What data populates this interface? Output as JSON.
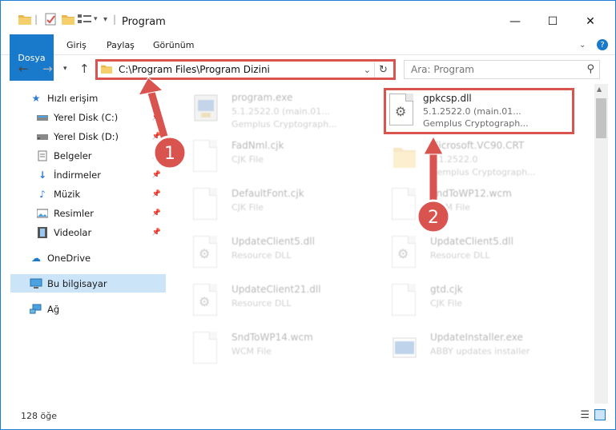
{
  "window": {
    "title": "Program",
    "controls": {
      "minimize": "—",
      "maximize": "☐",
      "close": "✕"
    }
  },
  "ribbon": {
    "tabs": [
      {
        "label": "Dosya"
      },
      {
        "label": "Giriş"
      },
      {
        "label": "Paylaş"
      },
      {
        "label": "Görünüm"
      }
    ]
  },
  "address": {
    "path": "C:\\Program Files\\Program Dizini"
  },
  "search": {
    "placeholder": "Ara: Program"
  },
  "sidebar": {
    "items": [
      {
        "label": "Hızlı erişim",
        "icon": "star-icon"
      },
      {
        "label": "Yerel Disk (C:)",
        "icon": "drive-icon"
      },
      {
        "label": "Yerel Disk (D:)",
        "icon": "drive-icon"
      },
      {
        "label": "Belgeler",
        "icon": "documents-icon"
      },
      {
        "label": "İndirmeler",
        "icon": "download-icon"
      },
      {
        "label": "Müzik",
        "icon": "music-icon"
      },
      {
        "label": "Resimler",
        "icon": "pictures-icon"
      },
      {
        "label": "Videolar",
        "icon": "video-icon"
      },
      {
        "label": "OneDrive",
        "icon": "cloud-icon"
      },
      {
        "label": "Bu bilgisayar",
        "icon": "computer-icon"
      },
      {
        "label": "Ağ",
        "icon": "network-icon"
      }
    ]
  },
  "files": [
    {
      "name": "program.exe",
      "line1": "5.1.2522.0 (main.01...",
      "line2": "Gemplus Cryptograph..."
    },
    {
      "name": "gpkcsp.dll",
      "line1": "5.1.2522.0 (main.01...",
      "line2": "Gemplus Cryptograph..."
    },
    {
      "name": "FadNml.cjk",
      "line1": "CJK File",
      "line2": ""
    },
    {
      "name": "Microsoft.VC90.CRT",
      "line1": "5.1.2522.0",
      "line2": "Gemplus Cryptograph..."
    },
    {
      "name": "DefaultFont.cjk",
      "line1": "CJK File",
      "line2": ""
    },
    {
      "name": "SndToWP12.wcm",
      "line1": "WCM File",
      "line2": ""
    },
    {
      "name": "UpdateClient5.dll",
      "line1": "Resource DLL",
      "line2": ""
    },
    {
      "name": "UpdateClient5.dll",
      "line1": "Resource DLL",
      "line2": ""
    },
    {
      "name": "UpdateClient21.dll",
      "line1": "Resource DLL",
      "line2": ""
    },
    {
      "name": "gtd.cjk",
      "line1": "CJK File",
      "line2": ""
    },
    {
      "name": "SndToWP14.wcm",
      "line1": "WCM File",
      "line2": ""
    },
    {
      "name": "UpdateInstaller.exe",
      "line1": "ABBY updates installer",
      "line2": ""
    }
  ],
  "annotations": {
    "step1": "1",
    "step2": "2"
  },
  "status": {
    "count": "128 öğe"
  },
  "colors": {
    "accent": "#1979ca",
    "annotation": "#d9534f",
    "selected": "#cce4f7"
  }
}
